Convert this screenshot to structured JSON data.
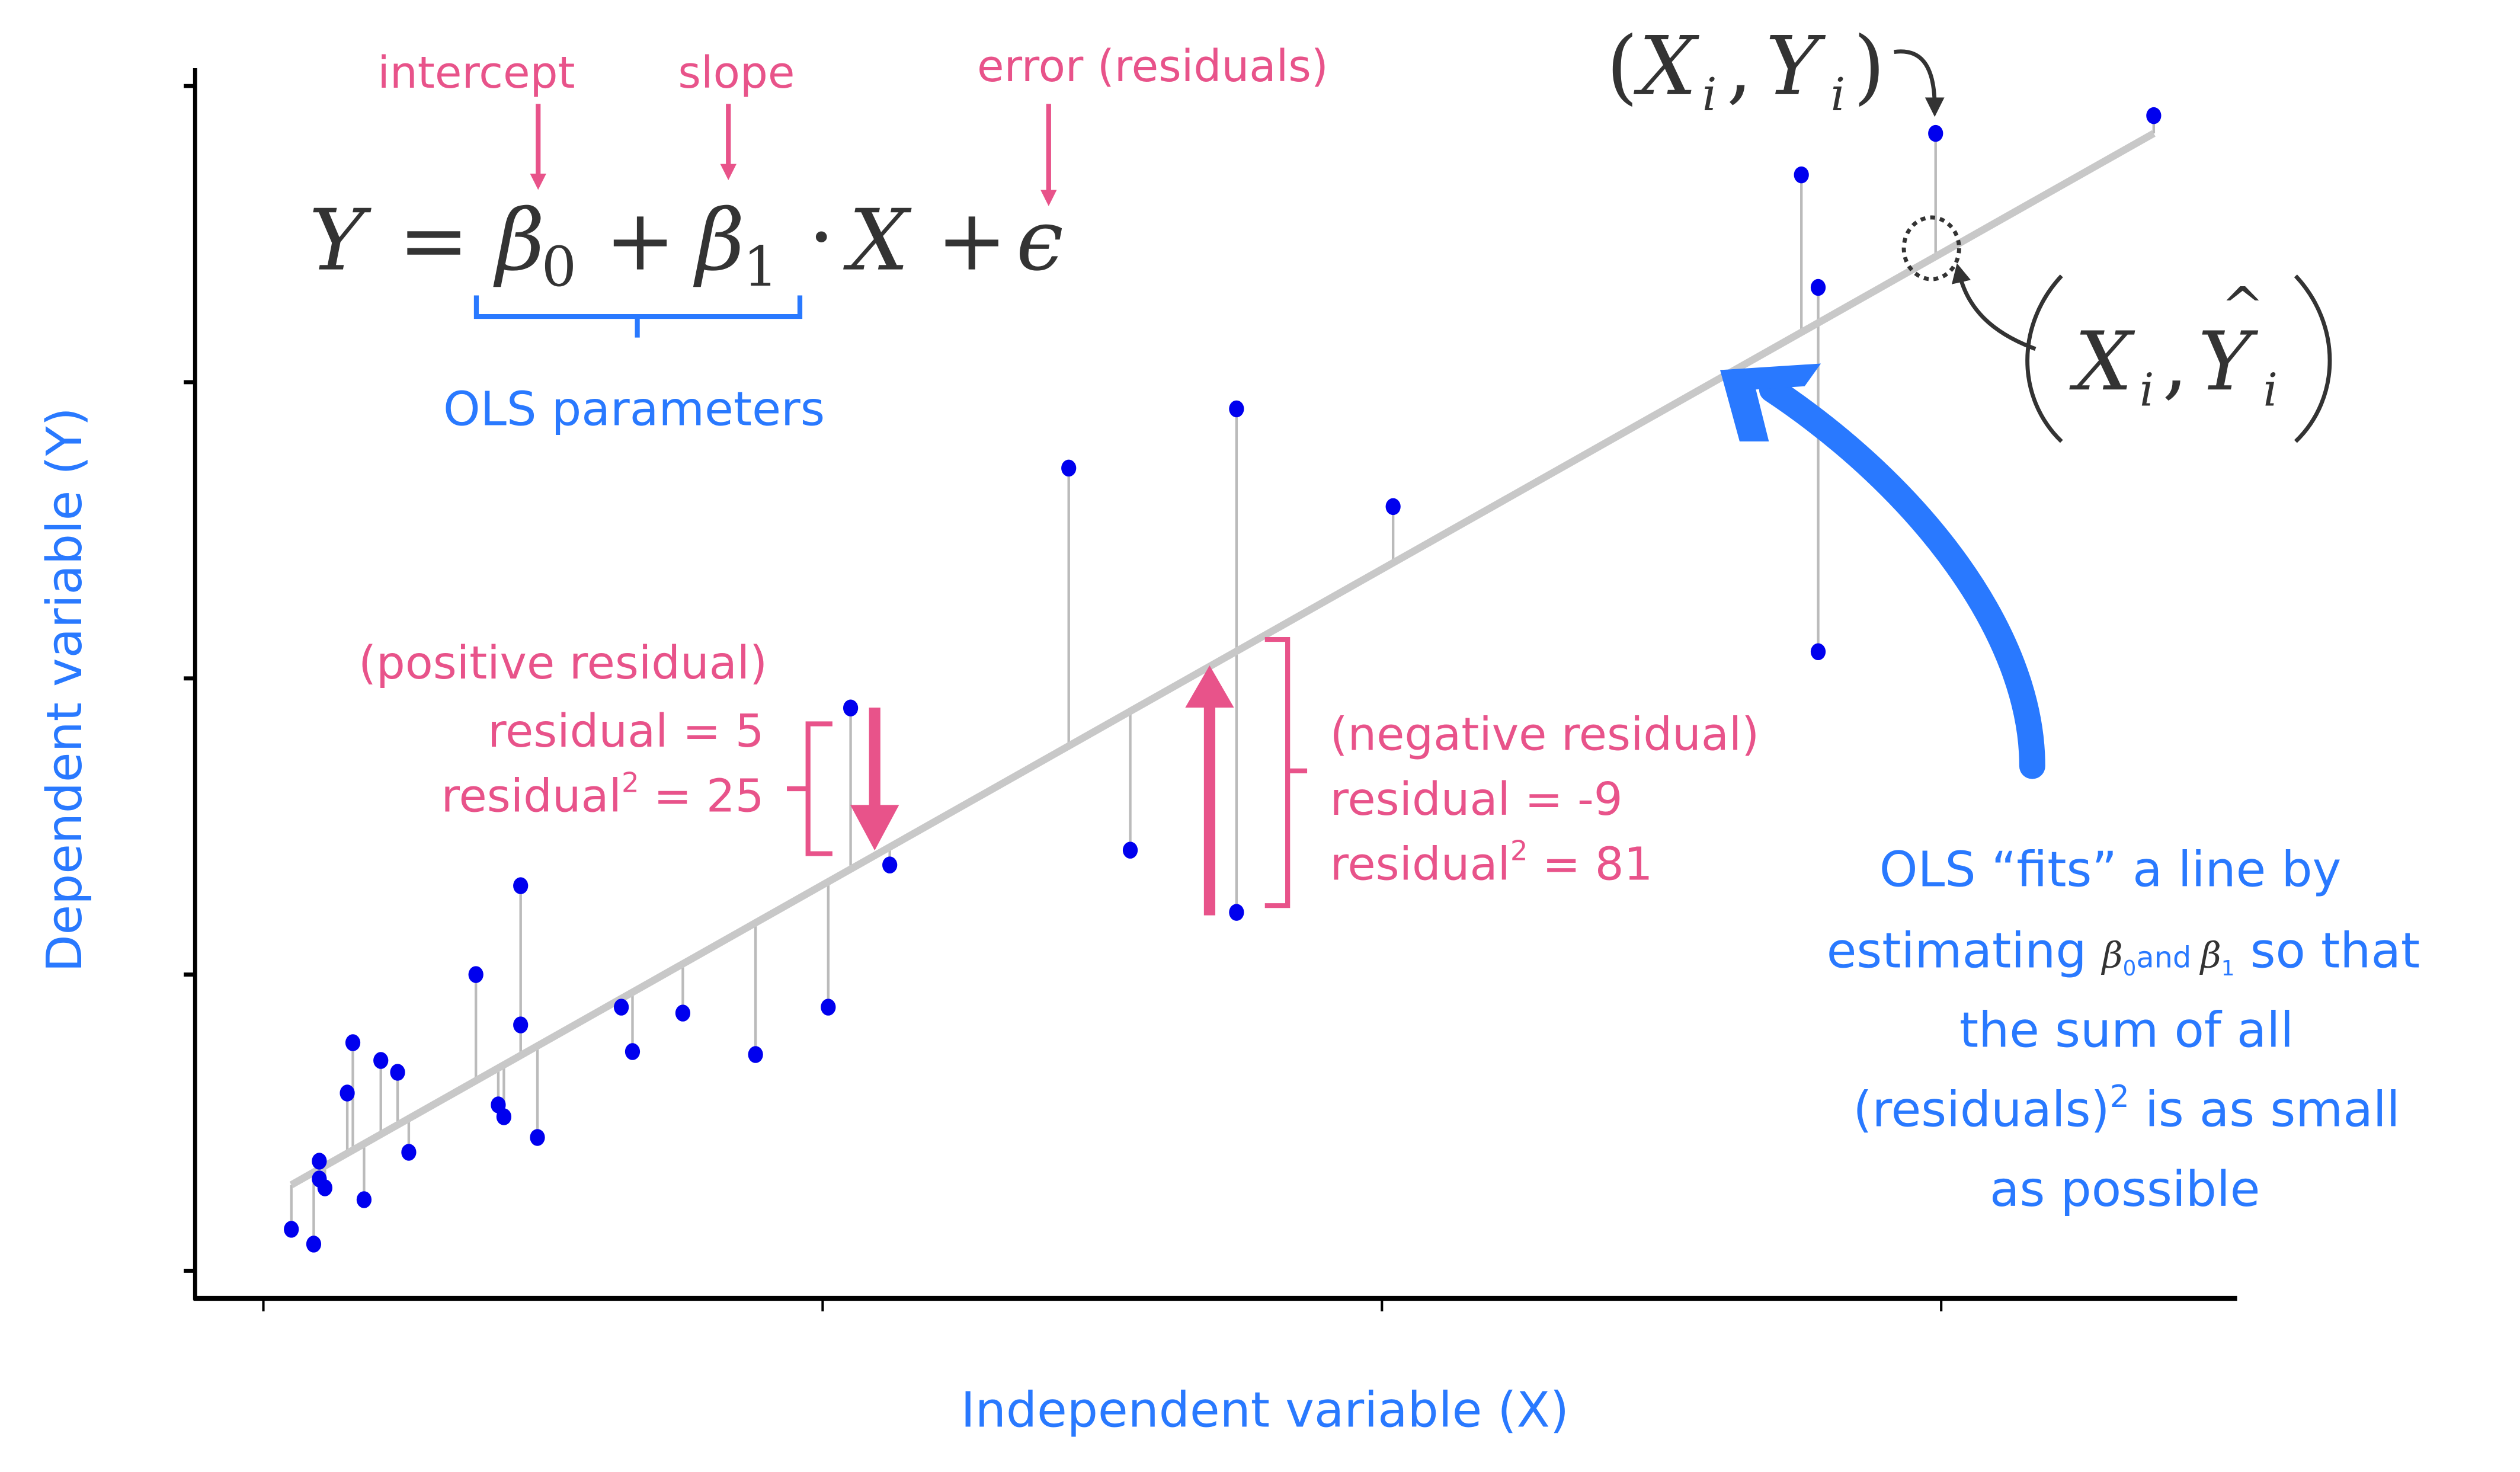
{
  "colors": {
    "annotation_pink": "#e8538a",
    "annotation_blue": "#2979ff",
    "points": "#0000ee",
    "fit_line": "#c8c8c8",
    "residual_lines": "#bbbbbb",
    "math_text": "#333333",
    "axes": "#000000"
  },
  "equation": {
    "lhs": "Y",
    "equals": "=",
    "beta0": "β",
    "beta0_sub": "0",
    "plus1": "+",
    "beta1": "β",
    "beta1_sub": "1",
    "dot": "·",
    "x": "X",
    "plus2": "+",
    "epsilon": "ϵ"
  },
  "labels": {
    "intercept": "intercept",
    "slope": "slope",
    "error": "error (residuals)",
    "ols_parameters": "OLS parameters",
    "observed_point": {
      "open": "(",
      "x": "X",
      "xi": "i",
      "comma": ",",
      "y": "Y",
      "yi": "i",
      "close": ")"
    },
    "fitted_point": {
      "x": "X",
      "xi": "i",
      "comma": ",",
      "y": "Y",
      "hat": "^",
      "yi": "i"
    },
    "positive_residual": {
      "title": "(positive residual)",
      "residual_line": "residual = 5",
      "squared_prefix": "residual",
      "squared_sup": "2",
      "squared_suffix": " =  25"
    },
    "negative_residual": {
      "title": "(negative residual)",
      "residual_line": "residual = -9",
      "squared_prefix": "residual",
      "squared_sup": "2",
      "squared_suffix": " = 81"
    },
    "explanation": {
      "line1": "OLS “fits” a line  by",
      "line2_a": "estimating ",
      "line2_b0": "β",
      "line2_b0_sub": "0",
      "line2_and": "and ",
      "line2_b1": "β",
      "line2_b1_sub": "1",
      "line2_c": " so that",
      "line3": "the sum of all",
      "line4_a": "(residuals)",
      "line4_sup": "2",
      "line4_b": " is as small",
      "line5": "as possible"
    }
  },
  "chart_data": {
    "type": "scatter",
    "title": "",
    "xlabel": "Independent variable (X)",
    "ylabel": "Dependent variable (Y)",
    "x_ticks": [
      0,
      1,
      2,
      3
    ],
    "x_tick_labels": [
      "",
      "",
      "",
      ""
    ],
    "y_ticks": [
      0,
      1,
      2,
      3,
      4
    ],
    "y_tick_labels": [
      "",
      "",
      "",
      "",
      ""
    ],
    "xlim": [
      -0.12,
      3.5
    ],
    "ylim": [
      -0.1,
      4.04
    ],
    "grid": false,
    "legend": "none",
    "regression_line": {
      "x_start": 0.05,
      "x_end": 3.38,
      "y_start": 0.29,
      "y_end": 3.84
    },
    "points": [
      {
        "x": 0.05,
        "y": 0.14
      },
      {
        "x": 0.09,
        "y": 0.09
      },
      {
        "x": 0.1,
        "y": 0.37
      },
      {
        "x": 0.1,
        "y": 0.31
      },
      {
        "x": 0.11,
        "y": 0.28
      },
      {
        "x": 0.15,
        "y": 0.6
      },
      {
        "x": 0.16,
        "y": 0.77
      },
      {
        "x": 0.18,
        "y": 0.24
      },
      {
        "x": 0.21,
        "y": 0.71
      },
      {
        "x": 0.24,
        "y": 0.67
      },
      {
        "x": 0.26,
        "y": 0.4
      },
      {
        "x": 0.38,
        "y": 1.0
      },
      {
        "x": 0.42,
        "y": 0.56
      },
      {
        "x": 0.43,
        "y": 0.52
      },
      {
        "x": 0.46,
        "y": 1.3
      },
      {
        "x": 0.46,
        "y": 0.83
      },
      {
        "x": 0.49,
        "y": 0.45
      },
      {
        "x": 0.64,
        "y": 0.89
      },
      {
        "x": 0.66,
        "y": 0.74
      },
      {
        "x": 0.75,
        "y": 0.87
      },
      {
        "x": 0.88,
        "y": 0.73
      },
      {
        "x": 1.01,
        "y": 0.89
      },
      {
        "x": 1.05,
        "y": 1.9
      },
      {
        "x": 1.12,
        "y": 1.37
      },
      {
        "x": 1.44,
        "y": 2.71
      },
      {
        "x": 1.55,
        "y": 1.42
      },
      {
        "x": 1.74,
        "y": 2.91
      },
      {
        "x": 1.74,
        "y": 1.21
      },
      {
        "x": 2.02,
        "y": 2.58
      },
      {
        "x": 2.75,
        "y": 3.7
      },
      {
        "x": 2.78,
        "y": 3.32
      },
      {
        "x": 2.78,
        "y": 2.09
      },
      {
        "x": 2.99,
        "y": 3.84
      },
      {
        "x": 3.38,
        "y": 3.9
      }
    ],
    "annotations": [
      {
        "text": "residual = 5",
        "kind": "positive residual"
      },
      {
        "text": "residual = -9",
        "kind": "negative residual"
      }
    ]
  }
}
